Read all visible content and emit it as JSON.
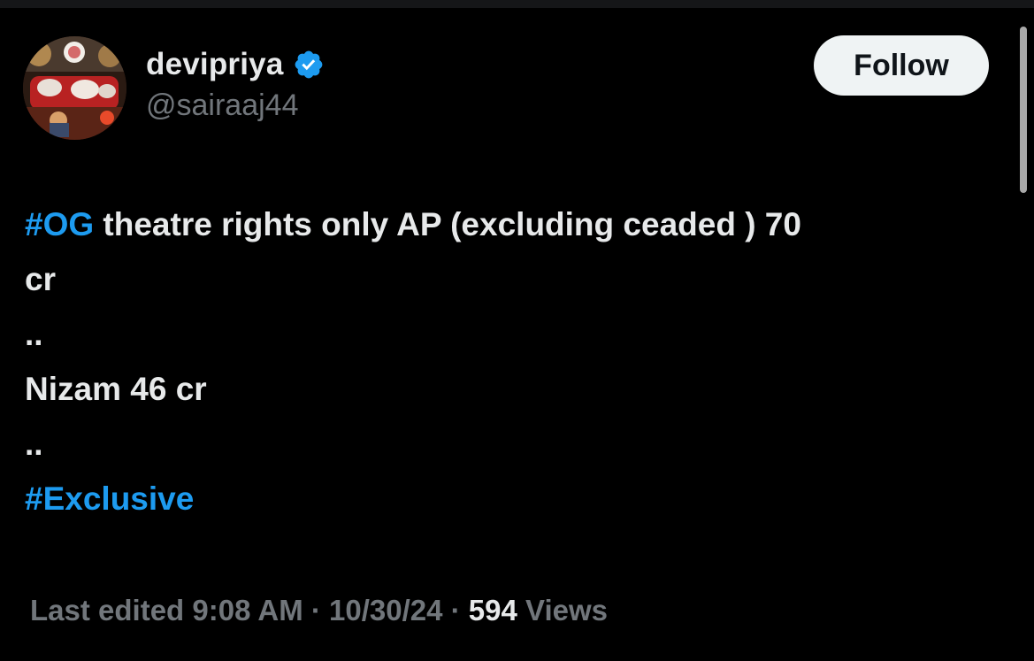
{
  "user": {
    "display_name": "devipriya",
    "handle": "@sairaaj44",
    "verified_icon": "verified-badge-icon",
    "avatar_icon": "avatar-image"
  },
  "follow_button": {
    "label": "Follow"
  },
  "tweet": {
    "hashtag_og": "#OG",
    "line1_rest": " theatre rights only AP (excluding ceaded ) 70",
    "line2": "cr",
    "sep1": "..",
    "line4": "Nizam 46 cr",
    "sep2": "..",
    "hashtag_exclusive": "#Exclusive"
  },
  "meta": {
    "edited_prefix": "Last edited 9:08 AM · 10/30/24",
    "dot": "  · ",
    "views_count": "594",
    "views_label": " Views"
  },
  "colors": {
    "background": "#000000",
    "text_primary": "#e7e9ea",
    "text_secondary": "#71767b",
    "link": "#1d9bf0",
    "follow_bg": "#eff3f4",
    "follow_text": "#0f1419"
  }
}
